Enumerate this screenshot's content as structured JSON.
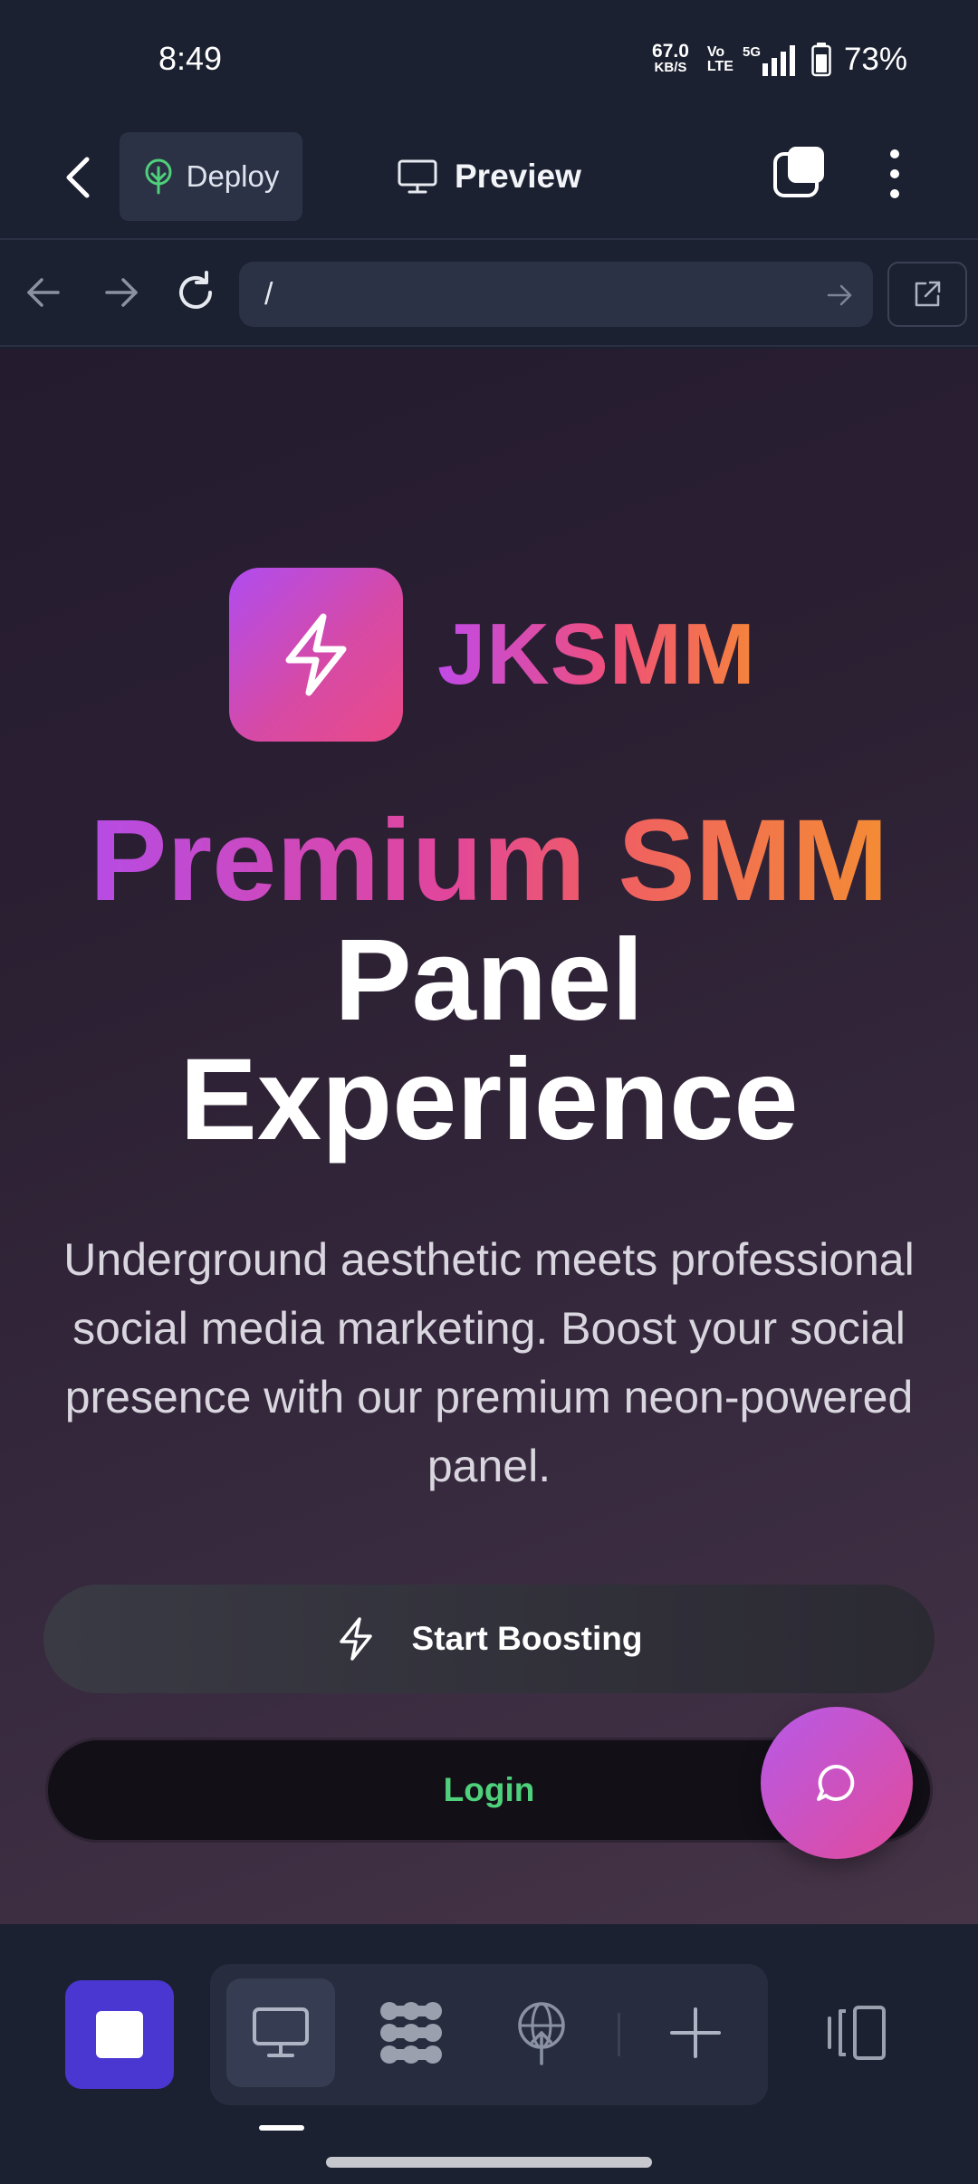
{
  "status_bar": {
    "time": "8:49",
    "net_speed": "67.0",
    "net_unit": "KB/S",
    "volte_top": "Vo",
    "volte_bottom": "LTE",
    "signal_label": "5G",
    "battery": "73%"
  },
  "header": {
    "deploy_label": "Deploy",
    "preview_label": "Preview"
  },
  "browser": {
    "url": "/"
  },
  "page": {
    "brand": "JKSMM",
    "hero_line1": "Premium SMM",
    "hero_line2": "Panel",
    "hero_line3": "Experience",
    "subtitle": "Underground aesthetic meets professional social media marketing. Boost your social presence with our premium neon-powered panel.",
    "cta_primary": "Start Boosting",
    "cta_secondary": "Login"
  },
  "colors": {
    "accent_purple": "#b04cf0",
    "accent_pink": "#e24a9a",
    "accent_orange": "#f5853a",
    "login_green": "#4fd07a",
    "stop_button": "#4a36d0"
  },
  "icons": {
    "back": "chevron-left-icon",
    "deploy": "deploy-tree-icon",
    "preview": "monitor-icon",
    "tabs": "tabs-icon",
    "more": "more-vertical-icon",
    "nav_back": "arrow-left-icon",
    "nav_forward": "arrow-right-icon",
    "reload": "reload-icon",
    "open_external": "external-link-icon",
    "logo": "lightning-icon",
    "chat": "chat-bubble-icon",
    "stop": "stop-icon",
    "desktop": "desktop-icon",
    "apps": "grid-dots-icon",
    "publish": "globe-upload-icon",
    "add": "plus-icon",
    "panel": "split-panel-icon"
  }
}
